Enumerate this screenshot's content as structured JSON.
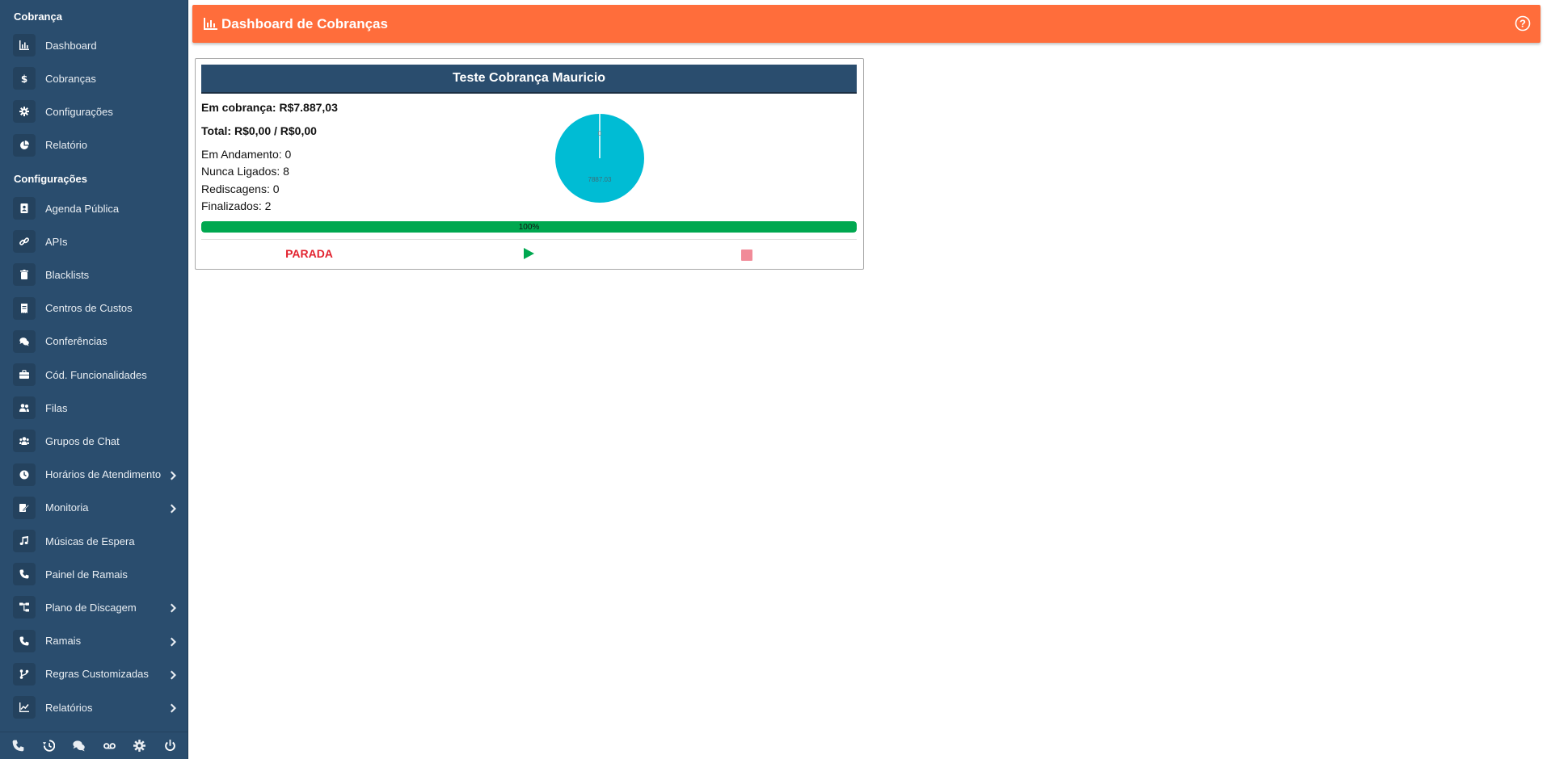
{
  "sidebar": {
    "sections": [
      {
        "title": "Cobrança",
        "items": [
          {
            "label": "Dashboard",
            "icon": "chart-bar-icon"
          },
          {
            "label": "Cobranças",
            "icon": "dollar-icon"
          },
          {
            "label": "Configurações",
            "icon": "gear-icon"
          },
          {
            "label": "Relatório",
            "icon": "pie-chart-icon"
          }
        ]
      },
      {
        "title": "Configurações",
        "items": [
          {
            "label": "Agenda Pública",
            "icon": "address-book-icon"
          },
          {
            "label": "APIs",
            "icon": "link-icon"
          },
          {
            "label": "Blacklists",
            "icon": "trash-icon"
          },
          {
            "label": "Centros de Custos",
            "icon": "receipt-icon"
          },
          {
            "label": "Conferências",
            "icon": "comments-icon"
          },
          {
            "label": "Cód. Funcionalidades",
            "icon": "briefcase-icon"
          },
          {
            "label": "Filas",
            "icon": "user-friends-icon"
          },
          {
            "label": "Grupos de Chat",
            "icon": "users-icon"
          },
          {
            "label": "Horários de Atendimento",
            "icon": "clock-icon",
            "has_submenu": true
          },
          {
            "label": "Monitoria",
            "icon": "edit-icon",
            "has_submenu": true
          },
          {
            "label": "Músicas de Espera",
            "icon": "music-icon"
          },
          {
            "label": "Painel de Ramais",
            "icon": "phone-icon"
          },
          {
            "label": "Plano de Discagem",
            "icon": "sitemap-icon",
            "has_submenu": true
          },
          {
            "label": "Ramais",
            "icon": "phone-icon",
            "has_submenu": true
          },
          {
            "label": "Regras Customizadas",
            "icon": "code-branch-icon",
            "has_submenu": true
          },
          {
            "label": "Relatórios",
            "icon": "line-chart-icon",
            "has_submenu": true
          }
        ]
      }
    ],
    "footer": [
      "phone-icon",
      "history-icon",
      "comments-icon",
      "voicemail-icon",
      "gear-icon",
      "power-icon"
    ]
  },
  "header": {
    "title": "Dashboard de Cobranças",
    "color": "#ff6d3b"
  },
  "campaign": {
    "title": "Teste Cobrança Mauricio",
    "em_cobranca": "Em cobrança: R$7.887,03",
    "total": "Total: R$0,00 / R$0,00",
    "em_andamento": "Em Andamento: 0",
    "nunca_ligados": "Nunca Ligados: 8",
    "rediscagens": "Rediscagens: 0",
    "finalizados": "Finalizados: 2",
    "progress_label": "100%",
    "progress_value": 100,
    "status": "PARADA",
    "pie": {
      "slices": [
        {
          "label": "0",
          "value": 0,
          "color": "#ffffff"
        },
        {
          "label": "7887.03",
          "value": 7887.03,
          "color": "#00bcd4"
        }
      ]
    }
  }
}
